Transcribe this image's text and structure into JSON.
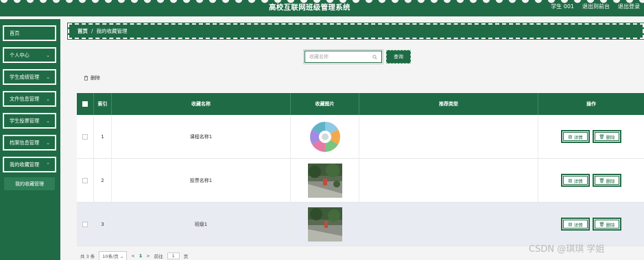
{
  "header": {
    "title": "高校互联网班级管理系统",
    "user_label": "学生 001",
    "exit_front": "退出到前台",
    "logout": "退出登录"
  },
  "sidebar": {
    "items": [
      {
        "label": "首页",
        "has_children": false
      },
      {
        "label": "个人中心",
        "has_children": true
      },
      {
        "label": "学生成绩管理",
        "has_children": true
      },
      {
        "label": "文件信息管理",
        "has_children": true
      },
      {
        "label": "学生投票管理",
        "has_children": true
      },
      {
        "label": "档案信息管理",
        "has_children": true
      },
      {
        "label": "我的收藏管理",
        "has_children": true
      }
    ],
    "submenu_active": "我的收藏管理"
  },
  "breadcrumb": {
    "home": "首页",
    "separator": "/",
    "current": "我的收藏管理"
  },
  "search": {
    "placeholder": "收藏名称",
    "button": "查询"
  },
  "toolbar": {
    "delete_label": "删除"
  },
  "table": {
    "headers": [
      "索引",
      "收藏名称",
      "收藏图片",
      "推荐类型",
      "操作"
    ],
    "rows": [
      {
        "index": "1",
        "name": "课程名称1",
        "image": "circle-diagram",
        "type": ""
      },
      {
        "index": "2",
        "name": "投票名称1",
        "image": "campus-photo",
        "type": ""
      },
      {
        "index": "3",
        "name": "班级1",
        "image": "campus-photo",
        "type": ""
      }
    ],
    "detail_label": "详情",
    "delete_label": "删除"
  },
  "pagination": {
    "total_prefix": "共",
    "total": "3",
    "total_suffix": "条",
    "page_size": "10条/页",
    "prev": "<",
    "current_page": "1",
    "next": ">",
    "goto_label": "前往",
    "goto_value": "1",
    "page_suffix": "页"
  },
  "watermark": "CSDN @琪琪 学姐",
  "colors": {
    "primary": "#1f6b45",
    "row_shaded": "#e9ebf2"
  }
}
